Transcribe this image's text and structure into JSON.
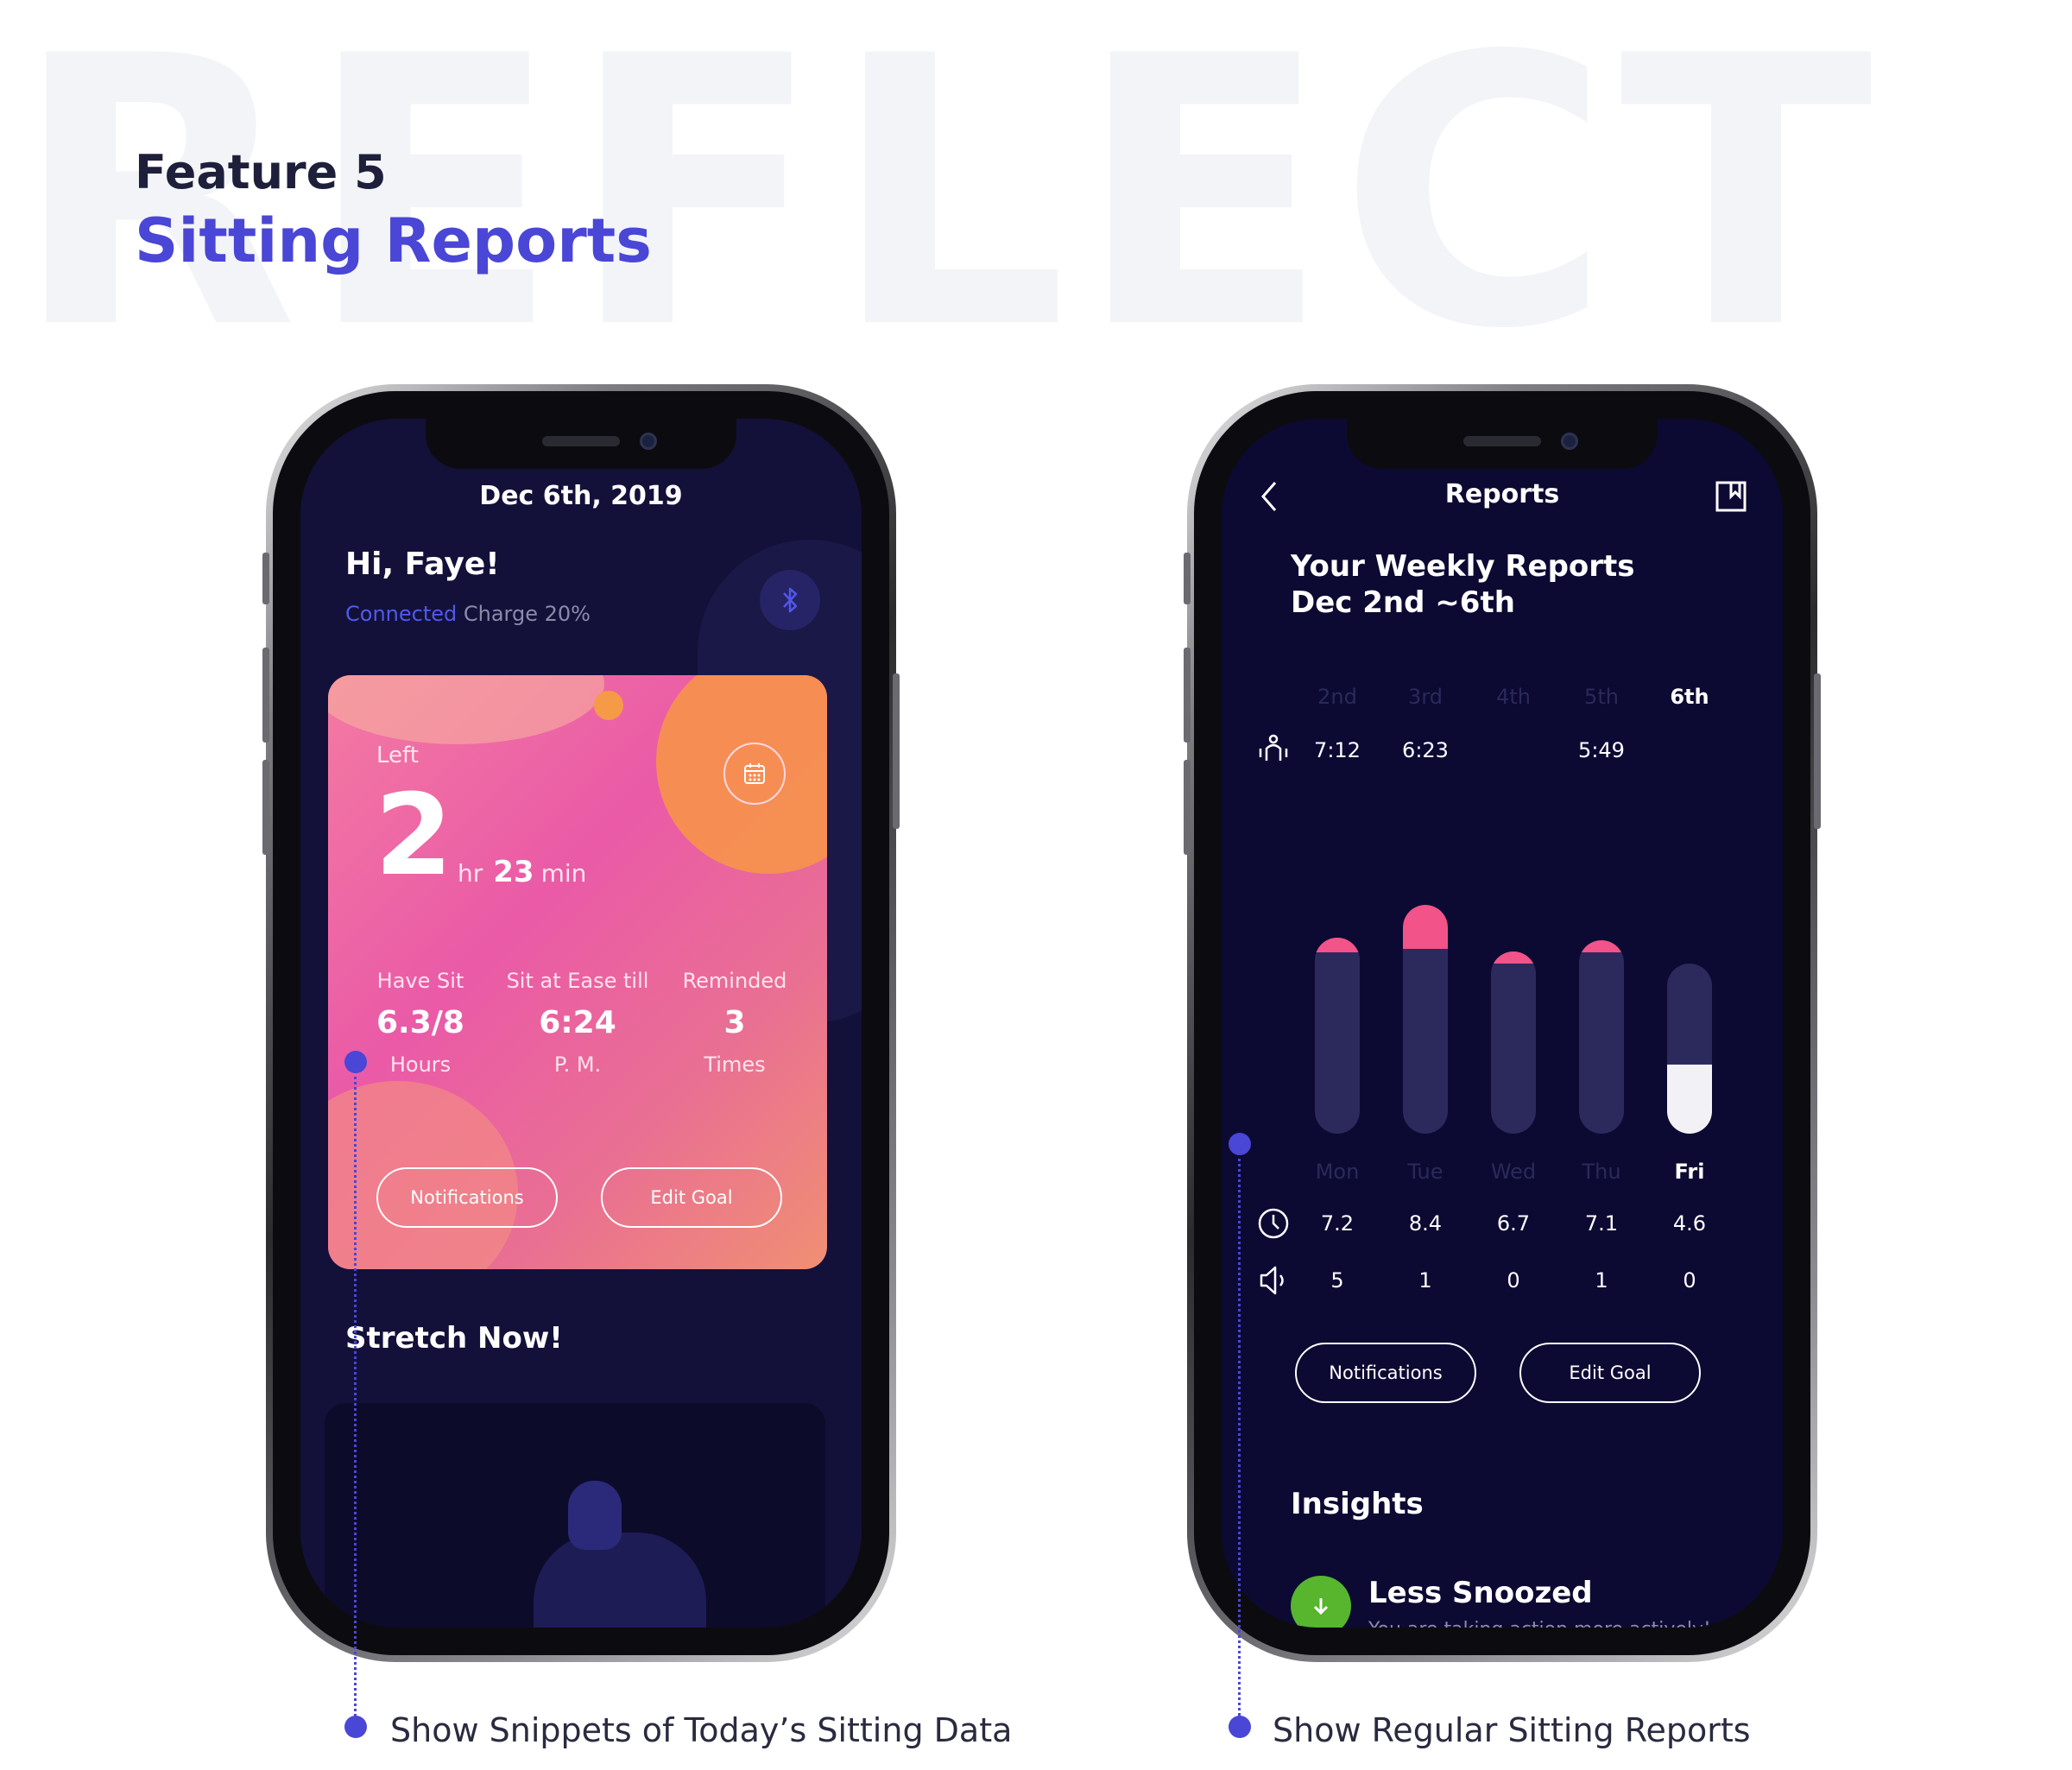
{
  "header": {
    "bg_word": "REFLECT",
    "feature_label": "Feature 5",
    "feature_title": "Sitting Reports"
  },
  "left_phone": {
    "date": "Dec 6th, 2019",
    "greeting": "Hi, Faye!",
    "status_connected": "Connected",
    "status_charge": "Charge 20%",
    "card": {
      "left_label": "Left",
      "hours_value": "2",
      "hours_unit": "hr",
      "minutes_value": "23",
      "minutes_unit": "min",
      "stats": [
        {
          "header": "Have Sit",
          "value": "6.3/8",
          "unit": "Hours"
        },
        {
          "header": "Sit at Ease till",
          "value": "6:24",
          "unit": "P. M."
        },
        {
          "header": "Reminded",
          "value": "3",
          "unit": "Times"
        }
      ],
      "notifications_label": "Notifications",
      "edit_goal_label": "Edit Goal"
    },
    "stretch_title": "Stretch Now!"
  },
  "right_phone": {
    "nav_title": "Reports",
    "weekly_title": "Your Weekly Reports",
    "weekly_range": "Dec 2nd ~6th",
    "top_days": [
      "2nd",
      "3rd",
      "4th",
      "5th",
      "6th"
    ],
    "pose_times": [
      "7:12",
      "6:23",
      "",
      "5:49",
      ""
    ],
    "chart_data": {
      "type": "bar",
      "categories": [
        "Mon",
        "Tue",
        "Wed",
        "Thu",
        "Fri"
      ],
      "series": [
        {
          "values": [
            7.2,
            8.4,
            6.7,
            7.1,
            4.6
          ]
        },
        {
          "values": [
            5,
            1,
            0,
            1,
            0
          ]
        }
      ],
      "selected": "Fri",
      "colors": {
        "over_goal": "#f25389",
        "track": "#2c2a5c",
        "selected_fill": "#f2f2f6"
      },
      "goal_hours": 8,
      "ylim": [
        0,
        10
      ]
    },
    "hours_row": [
      "7.2",
      "8.4",
      "6.7",
      "7.1",
      "4.6"
    ],
    "snooze_row": [
      "5",
      "1",
      "0",
      "1",
      "0"
    ],
    "notifications_label": "Notifications",
    "edit_goal_label": "Edit Goal",
    "insights_title": "Insights",
    "insight": {
      "title": "Less Snoozed",
      "subtitle": "You are taking action more actively!"
    }
  },
  "captions": {
    "left": "Show Snippets of Today’s Sitting Data",
    "right": "Show Regular Sitting Reports"
  },
  "colors": {
    "accent": "#4a46d6",
    "screen_bg": "#0c0a33",
    "card_pink": "#ea5aa7",
    "card_orange": "#f08f73"
  }
}
